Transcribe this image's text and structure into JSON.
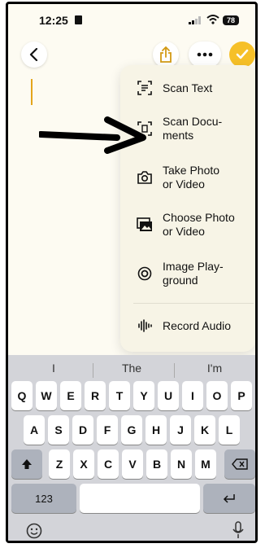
{
  "status": {
    "time": "12:25",
    "battery": "78"
  },
  "menu": {
    "items": [
      {
        "label": "Scan Text",
        "icon": "scan-text-icon"
      },
      {
        "label": "Scan Docu-\nments",
        "icon": "scan-documents-icon"
      },
      {
        "label": "Take Photo\nor Video",
        "icon": "camera-icon"
      },
      {
        "label": "Choose Photo\nor Video",
        "icon": "photo-library-icon"
      },
      {
        "label": "Image Play-\nground",
        "icon": "image-playground-icon"
      },
      {
        "label": "Record Audio",
        "icon": "waveform-icon"
      }
    ]
  },
  "keyboard": {
    "suggestions": [
      "I",
      "The",
      "I'm"
    ],
    "row1": [
      "Q",
      "W",
      "E",
      "R",
      "T",
      "Y",
      "U",
      "I",
      "O",
      "P"
    ],
    "row2": [
      "A",
      "S",
      "D",
      "F",
      "G",
      "H",
      "J",
      "K",
      "L"
    ],
    "row3": [
      "Z",
      "X",
      "C",
      "V",
      "B",
      "N",
      "M"
    ],
    "numbers_key": "123",
    "accent": "#f6c028"
  }
}
